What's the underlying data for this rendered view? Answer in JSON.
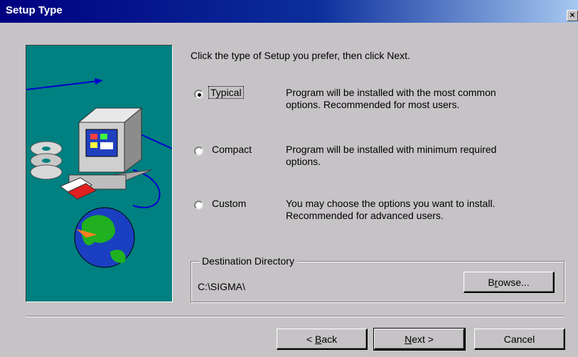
{
  "window": {
    "title": "Setup Type",
    "close_glyph": "×"
  },
  "prompt": "Click the type of Setup you prefer, then click Next.",
  "options": [
    {
      "label": "Typical",
      "description_line1": "Program will be installed with the most common",
      "description_line2": "options. Recommended for most users.",
      "selected": true
    },
    {
      "label": "Compact",
      "description_line1": "Program will be installed with minimum required",
      "description_line2": "options.",
      "selected": false
    },
    {
      "label": "Custom",
      "description_line1": "You may choose the options you want to install.",
      "description_line2": "Recommended for advanced users.",
      "selected": false
    }
  ],
  "destination": {
    "legend": "Destination Directory",
    "path": "C:\\SIGMA\\",
    "browse_pre": "B",
    "browse_mn": "r",
    "browse_post": "owse..."
  },
  "buttons": {
    "back_pre": "< ",
    "back_mn": "B",
    "back_post": "ack",
    "next_mn": "N",
    "next_post": "ext >",
    "cancel": "Cancel"
  }
}
